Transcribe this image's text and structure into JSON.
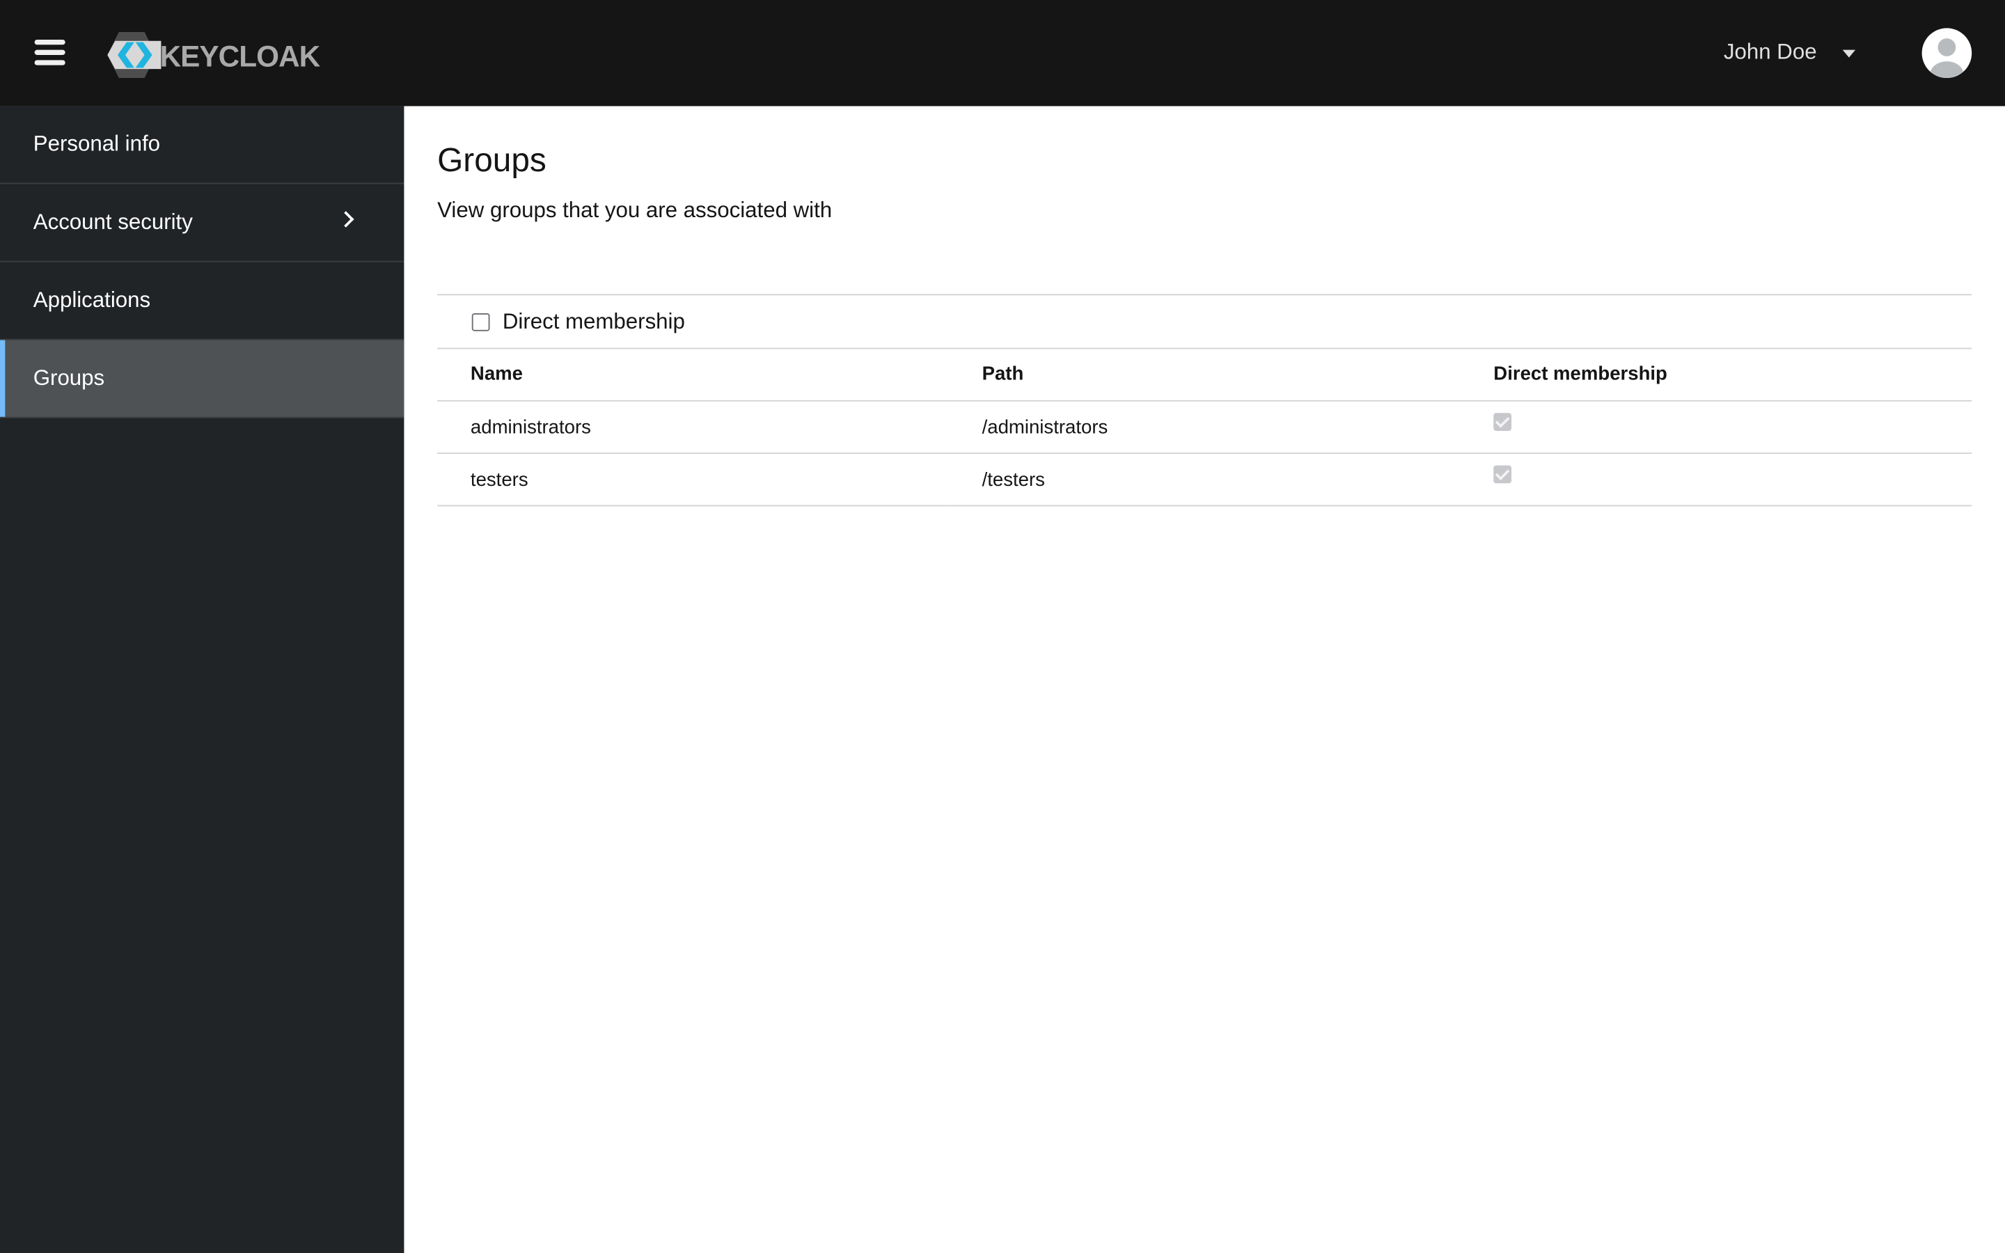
{
  "header": {
    "brand": "KEYCLOAK",
    "user_name": "John Doe"
  },
  "sidebar": {
    "items": [
      {
        "label": "Personal info"
      },
      {
        "label": "Account security"
      },
      {
        "label": "Applications"
      },
      {
        "label": "Groups"
      }
    ]
  },
  "main": {
    "title": "Groups",
    "subtitle": "View groups that you are associated with",
    "filter_label": "Direct membership",
    "filter_checked": false,
    "table": {
      "headers": [
        "Name",
        "Path",
        "Direct membership"
      ],
      "rows": [
        {
          "name": "administrators",
          "path": "/administrators",
          "direct": true
        },
        {
          "name": "testers",
          "path": "/testers",
          "direct": true
        }
      ]
    }
  }
}
